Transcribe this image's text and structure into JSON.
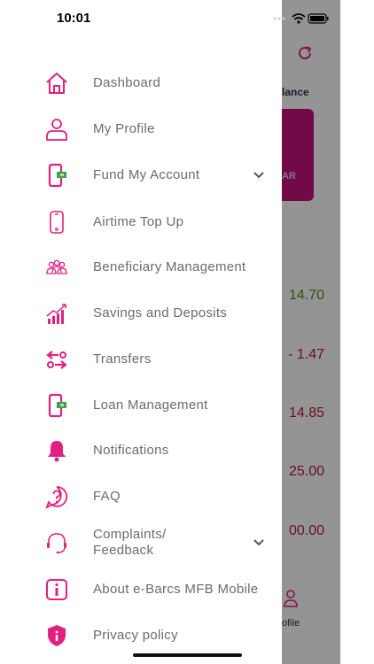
{
  "status_bar": {
    "time": "10:01"
  },
  "colors": {
    "accent": "#e0217f",
    "text": "#6b6b6b",
    "balance_green": "#5c8a1f",
    "amount_red": "#b0203a"
  },
  "menu": {
    "items": [
      {
        "label": "Dashboard",
        "icon": "home-icon",
        "expandable": false
      },
      {
        "label": "My Profile",
        "icon": "user-icon",
        "expandable": false
      },
      {
        "label": "Fund My Account",
        "icon": "fund-phone-icon",
        "expandable": true
      },
      {
        "label": "Airtime Top Up",
        "icon": "phone-icon",
        "expandable": false
      },
      {
        "label": "Beneficiary Management",
        "icon": "people-icon",
        "expandable": false
      },
      {
        "label": "Savings and Deposits",
        "icon": "growth-chart-icon",
        "expandable": false
      },
      {
        "label": "Transfers",
        "icon": "transfer-icon",
        "expandable": false
      },
      {
        "label": "Loan Management",
        "icon": "loan-phone-icon",
        "expandable": false
      },
      {
        "label": "Notifications",
        "icon": "bell-icon",
        "expandable": false
      },
      {
        "label": "FAQ",
        "icon": "question-icon",
        "expandable": false
      },
      {
        "label": "Complaints/\nFeedback",
        "icon": "headset-icon",
        "expandable": true
      },
      {
        "label": "About e-Barcs MFB Mobile",
        "icon": "info-icon",
        "expandable": false
      },
      {
        "label": "Privacy policy",
        "icon": "shield-icon",
        "expandable": false
      }
    ]
  },
  "background": {
    "balance_label": "lance",
    "card_text": "AR",
    "amounts": [
      "14.70",
      "- 1.47",
      "14.85",
      "25.00",
      "00.00"
    ],
    "tab_label": "ofile"
  }
}
